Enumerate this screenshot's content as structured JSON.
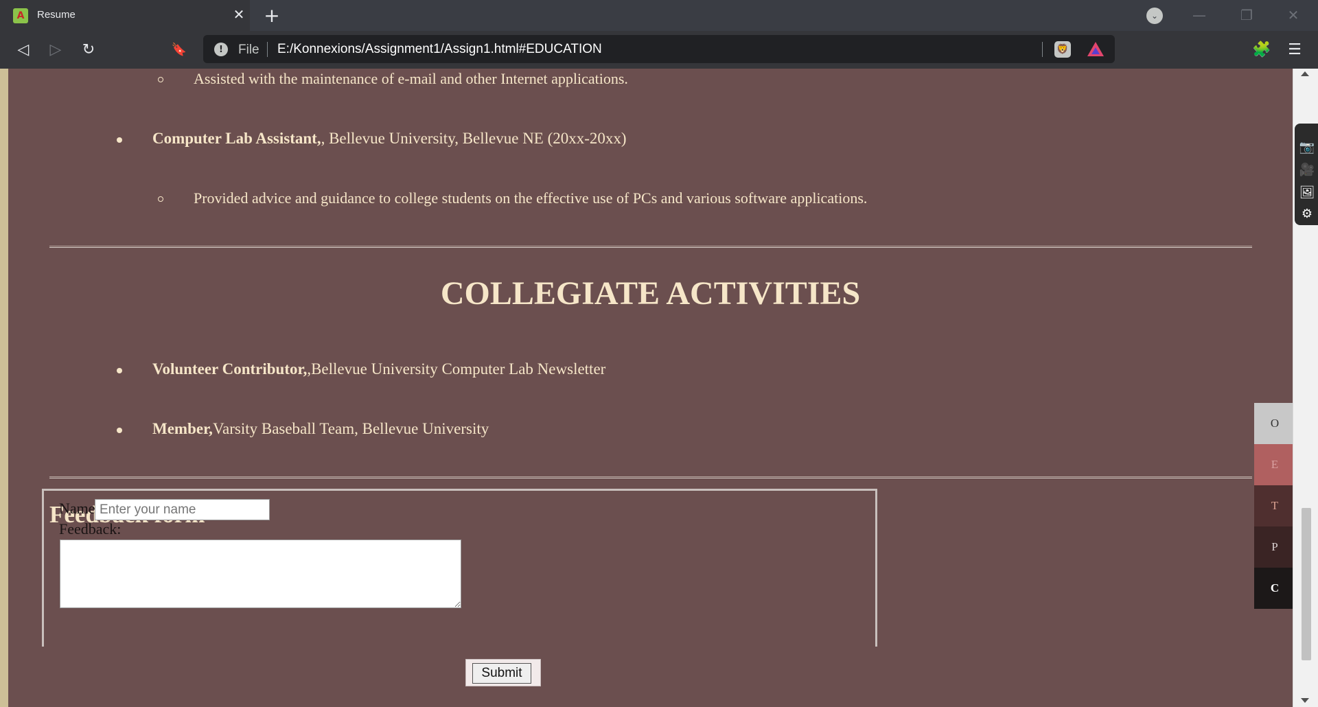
{
  "browser": {
    "tab_title": "Resume",
    "tab_favicon_letter": "A",
    "close_glyph": "✕",
    "new_tab_glyph": "+",
    "omnibox_file_label": "File",
    "url": "E:/Konnexions/Assignment1/Assign1.html#EDUCATION",
    "icons": {
      "back": "◁",
      "forward": "▷",
      "reload": "↻",
      "bookmark": "🔖",
      "info": "!",
      "brave_shield": "🦁",
      "extensions": "🧩",
      "menu": "☰",
      "tab_search": "⌄",
      "minimize": "—",
      "restore": "❐",
      "close_window": "✕"
    },
    "colors": {
      "tabbar": "#3a3d44",
      "toolbar": "#35363a",
      "omnibox": "#202124"
    }
  },
  "page": {
    "colors": {
      "background": "#6b4f4f",
      "text": "#f6e6c8"
    },
    "experience_items": [
      {
        "kind": "sub",
        "text": "Assisted with the maintenance of e-mail and other Internet applications."
      },
      {
        "kind": "main",
        "bold": "Computer Lab Assistant,",
        "text": ", Bellevue University, Bellevue NE (20xx-20xx)"
      },
      {
        "kind": "sub",
        "text": "Provided advice and guidance to college students on the effective use of PCs and various software applications."
      }
    ],
    "collegiate": {
      "title": "COLLEGIATE ACTIVITIES",
      "items": [
        {
          "bold": "Volunteer Contributor,",
          "text": ",Bellevue University Computer Lab Newsletter"
        },
        {
          "bold": "Member,",
          "text": "Varsity Baseball Team, Bellevue University"
        }
      ]
    },
    "feedback": {
      "title": "Feedback form",
      "name_label": "Name",
      "name_placeholder": "Enter your name",
      "feedback_label": "Feedback:",
      "submit_label": "Submit"
    },
    "side_nav": [
      {
        "letter": "O",
        "bg": "#c8c8c8",
        "fg": "#333333"
      },
      {
        "letter": "E",
        "bg": "#b06060",
        "fg": "#d9a0a0"
      },
      {
        "letter": "T",
        "bg": "#4f2f2f",
        "fg": "#d8a090"
      },
      {
        "letter": "P",
        "bg": "#3a2424",
        "fg": "#d8cfcf"
      },
      {
        "letter": "C",
        "bg": "#1c1818",
        "fg": "#ffffff"
      }
    ],
    "dock_icons": [
      "camera-icon",
      "video-icon",
      "gallery-icon",
      "settings-icon"
    ]
  }
}
